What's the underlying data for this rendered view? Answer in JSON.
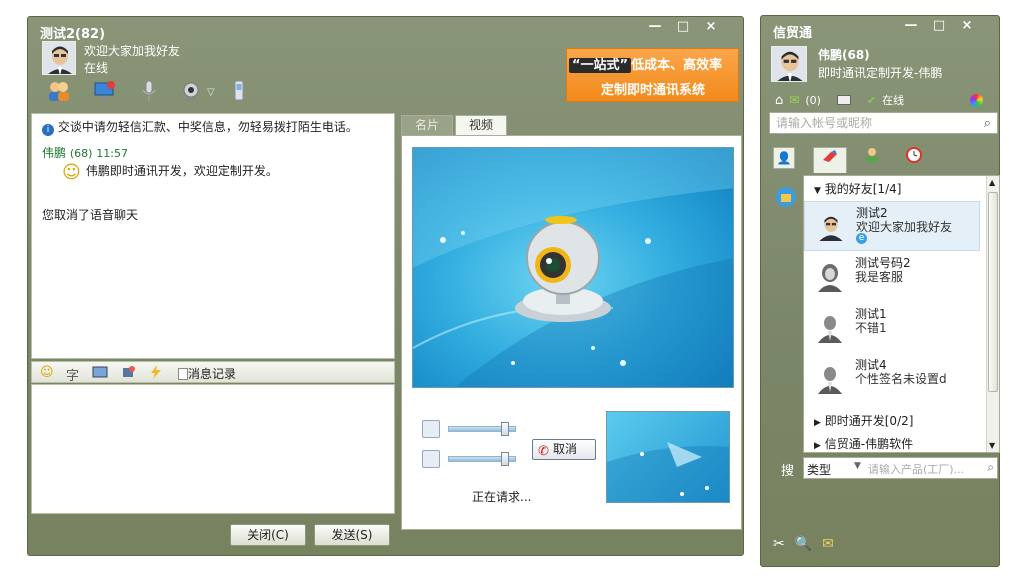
{
  "chat_window": {
    "title": "测试2(82)",
    "signature": "欢迎大家加我好友",
    "status": "在线",
    "controls": [
      "—",
      "□",
      "×"
    ],
    "toolbar_icons": [
      "contacts-icon",
      "remote-assist-icon",
      "microphone-icon",
      "webcam-icon",
      "phone-icon"
    ],
    "dropdown_arrow": "▽",
    "ad": {
      "tag": "“一站式”",
      "line1_rest": "低成本、高效率",
      "line2": "定制即时通讯系统"
    },
    "messages": {
      "notice": "交谈中请勿轻信汇款、中奖信息，勿轻易拨打陌生电话。",
      "sender": "伟鹏",
      "sender_id": "(68)",
      "time": "11:57",
      "emoji": "☺",
      "text": "伟鹏即时通讯开发，欢迎定制开发。",
      "system": "您取消了语音聊天"
    },
    "input_toolbar": {
      "emoji": "☺",
      "font": "字",
      "history_label": "消息记录"
    },
    "buttons": {
      "close": "关闭(C)",
      "send": "发送(S)"
    },
    "tabs": [
      "名片",
      "视频"
    ],
    "active_tab": "视频",
    "video": {
      "cancel": "取消",
      "status": "正在请求..."
    }
  },
  "main_panel": {
    "title": "信贸通",
    "controls": [
      "—",
      "□",
      "×"
    ],
    "user_name": "伟鹏(68)",
    "user_signature": "即时通讯定制开发-伟鹏",
    "mail_count": "(0)",
    "status": "在线",
    "search_placeholder": "请输入帐号或昵称",
    "groups": [
      {
        "name": "我的好友[1/4]",
        "expanded": true
      },
      {
        "name": "即时通开发[0/2]",
        "expanded": false
      },
      {
        "name": "信贸通-伟鹏软件",
        "expanded": false
      }
    ],
    "friends": [
      {
        "name": "测试2",
        "signature": "欢迎大家加我好友",
        "badge": "e"
      },
      {
        "name": "测试号码2",
        "signature": "我是客服"
      },
      {
        "name": "测试1",
        "signature": "不错1"
      },
      {
        "name": "测试4",
        "signature": "个性签名未设置d"
      }
    ],
    "product_search": {
      "label": "搜",
      "category": "类型",
      "placeholder": "请输入产品(工厂)..."
    }
  }
}
